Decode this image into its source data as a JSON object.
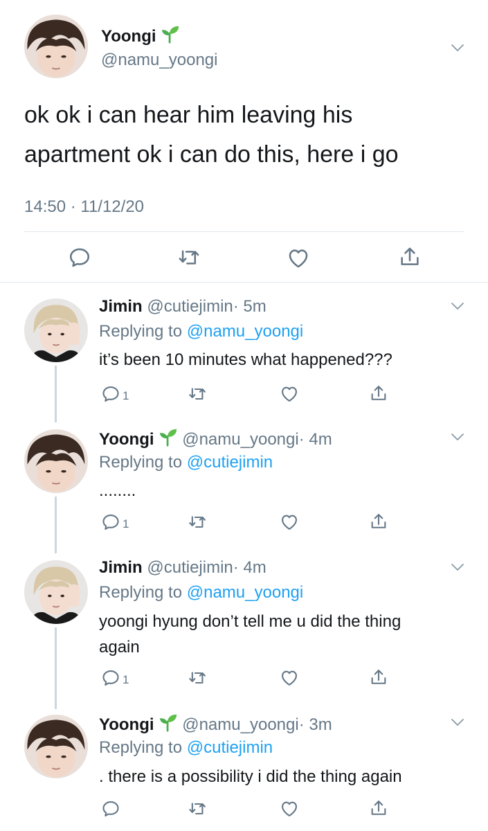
{
  "main_tweet": {
    "name": "Yoongi",
    "name_emoji": "seedling-icon",
    "handle": "@namu_yoongi",
    "text_line1": "ok ok i can hear him leaving his",
    "text_line2": "apartment ok i can do this, here i go",
    "timestamp": "14:50 · 11/12/20"
  },
  "replies": [
    {
      "name": "Jimin",
      "handle": "@cutiejimin",
      "time": "· 5m",
      "replying_prefix": "Replying to",
      "replying_to": "@namu_yoongi",
      "text_line1": "it’s been 10 minutes what happened???",
      "text_line2": "",
      "reply_count": "1"
    },
    {
      "name": "Yoongi",
      "name_emoji": "seedling-icon",
      "handle": "@namu_yoongi",
      "time": "· 4m",
      "replying_prefix": "Replying to",
      "replying_to": "@cutiejimin",
      "text_line1": "........",
      "text_line2": "",
      "reply_count": "1"
    },
    {
      "name": "Jimin",
      "handle": "@cutiejimin",
      "time": "· 4m",
      "replying_prefix": "Replying to",
      "replying_to": "@namu_yoongi",
      "text_line1": "yoongi hyung don’t tell me u did the thing",
      "text_line2": "again",
      "reply_count": "1"
    },
    {
      "name": "Yoongi",
      "name_emoji": "seedling-icon",
      "handle": "@namu_yoongi",
      "time": "· 3m",
      "replying_prefix": "Replying to",
      "replying_to": "@cutiejimin",
      "text_line1": ". there is a possibility i did the thing again",
      "text_line2": "",
      "reply_count": ""
    }
  ],
  "colors": {
    "link": "#1da1f2",
    "secondary_text": "#657786",
    "thread_line": "#ccd6dd",
    "seedling": "#4caf50"
  }
}
